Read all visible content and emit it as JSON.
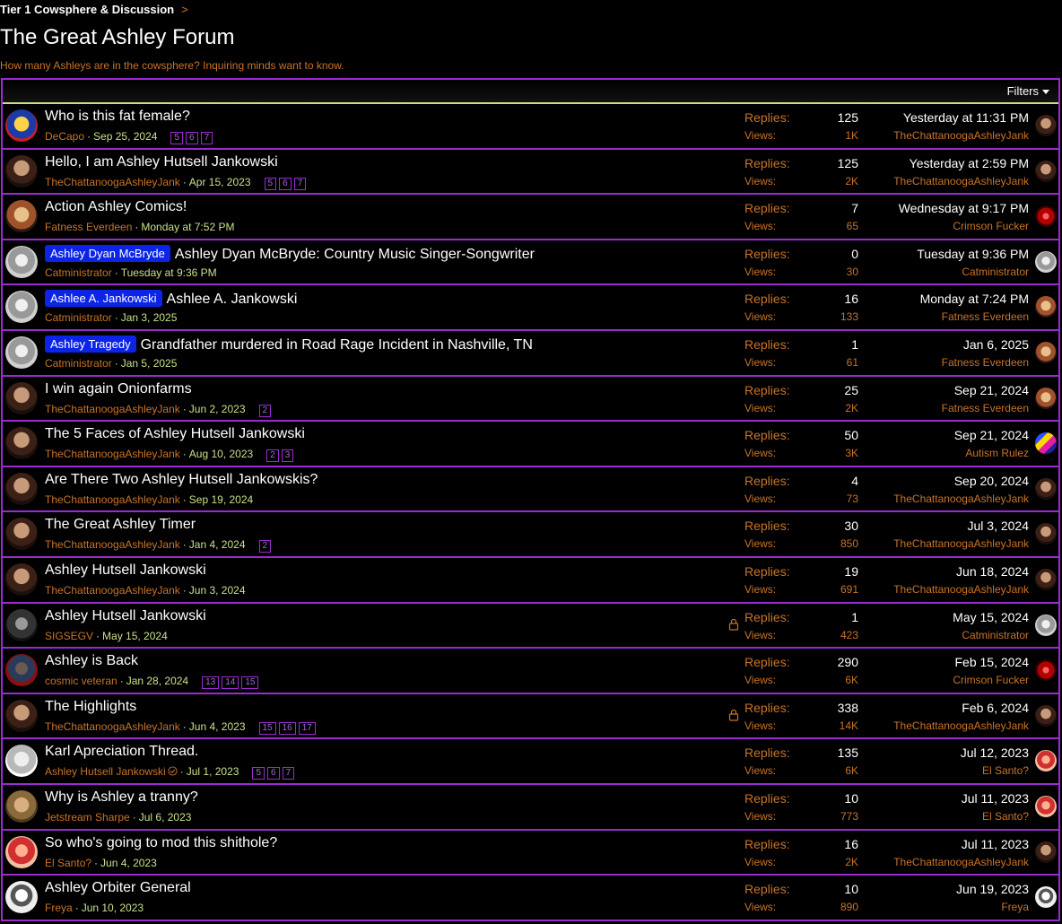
{
  "breadcrumb": {
    "label": "Tier 1 Cowsphere & Discussion",
    "sep": ">"
  },
  "forum": {
    "title": "The Great Ashley Forum",
    "description": "How many Ashleys are in the cowsphere? Inquiring minds want to know."
  },
  "filters_label": "Filters",
  "labels": {
    "replies": "Replies:",
    "views": "Views:"
  },
  "threads": [
    {
      "prefix": "",
      "title": "Who is this fat female?",
      "author": "DeCapo",
      "date": "Sep 25, 2024",
      "pages": [
        "5",
        "6",
        "7"
      ],
      "replies": "125",
      "views": "1K",
      "last_date": "Yesterday at 11:31 PM",
      "last_user": "TheChattanoogaAshleyJank",
      "locked": false,
      "avatar": "av-e",
      "last_avatar": "av-a"
    },
    {
      "prefix": "",
      "title": "Hello, I am Ashley Hutsell Jankowski",
      "author": "TheChattanoogaAshleyJank",
      "date": "Apr 15, 2023",
      "pages": [
        "5",
        "6",
        "7"
      ],
      "replies": "125",
      "views": "2K",
      "last_date": "Yesterday at 2:59 PM",
      "last_user": "TheChattanoogaAshleyJank",
      "locked": false,
      "avatar": "av-a",
      "last_avatar": "av-a"
    },
    {
      "prefix": "",
      "title": "Action Ashley Comics!",
      "author": "Fatness Everdeen",
      "date": "Monday at 7:52 PM",
      "pages": [],
      "replies": "7",
      "views": "65",
      "last_date": "Wednesday at 9:17 PM",
      "last_user": "Crimson Fucker",
      "locked": false,
      "avatar": "av-c",
      "last_avatar": "av-d"
    },
    {
      "prefix": "Ashley Dyan McBryde",
      "title": "Ashley Dyan McBryde: Country Music Singer-Songwriter",
      "author": "Catministrator",
      "date": "Tuesday at 9:36 PM",
      "pages": [],
      "replies": "0",
      "views": "30",
      "last_date": "Tuesday at 9:36 PM",
      "last_user": "Catministrator",
      "locked": false,
      "avatar": "av-b",
      "last_avatar": "av-b"
    },
    {
      "prefix": "Ashlee A. Jankowski",
      "title": "Ashlee A. Jankowski",
      "author": "Catministrator",
      "date": "Jan 3, 2025",
      "pages": [],
      "replies": "16",
      "views": "133",
      "last_date": "Monday at 7:24 PM",
      "last_user": "Fatness Everdeen",
      "locked": false,
      "avatar": "av-b",
      "last_avatar": "av-c"
    },
    {
      "prefix": "Ashley Tragedy",
      "title": "Grandfather murdered in Road Rage Incident in Nashville, TN",
      "author": "Catministrator",
      "date": "Jan 5, 2025",
      "pages": [],
      "replies": "1",
      "views": "61",
      "last_date": "Jan 6, 2025",
      "last_user": "Fatness Everdeen",
      "locked": false,
      "avatar": "av-b",
      "last_avatar": "av-c"
    },
    {
      "prefix": "",
      "title": "I win again Onionfarms",
      "author": "TheChattanoogaAshleyJank",
      "date": "Jun 2, 2023",
      "pages": [
        "2"
      ],
      "replies": "25",
      "views": "2K",
      "last_date": "Sep 21, 2024",
      "last_user": "Fatness Everdeen",
      "locked": false,
      "avatar": "av-a",
      "last_avatar": "av-c"
    },
    {
      "prefix": "",
      "title": "The 5 Faces of Ashley Hutsell Jankowski",
      "author": "TheChattanoogaAshleyJank",
      "date": "Aug 10, 2023",
      "pages": [
        "2",
        "3"
      ],
      "replies": "50",
      "views": "3K",
      "last_date": "Sep 21, 2024",
      "last_user": "Autism Rulez",
      "locked": false,
      "avatar": "av-a",
      "last_avatar": "av-l"
    },
    {
      "prefix": "",
      "title": "Are There Two Ashley Hutsell Jankowskis?",
      "author": "TheChattanoogaAshleyJank",
      "date": "Sep 19, 2024",
      "pages": [],
      "replies": "4",
      "views": "73",
      "last_date": "Sep 20, 2024",
      "last_user": "TheChattanoogaAshleyJank",
      "locked": false,
      "avatar": "av-a",
      "last_avatar": "av-a"
    },
    {
      "prefix": "",
      "title": "The Great Ashley Timer",
      "author": "TheChattanoogaAshleyJank",
      "date": "Jan 4, 2024",
      "pages": [
        "2"
      ],
      "replies": "30",
      "views": "850",
      "last_date": "Jul 3, 2024",
      "last_user": "TheChattanoogaAshleyJank",
      "locked": false,
      "avatar": "av-a",
      "last_avatar": "av-a"
    },
    {
      "prefix": "",
      "title": "Ashley Hutsell Jankowski",
      "author": "TheChattanoogaAshleyJank",
      "date": "Jun 3, 2024",
      "pages": [],
      "replies": "19",
      "views": "691",
      "last_date": "Jun 18, 2024",
      "last_user": "TheChattanoogaAshleyJank",
      "locked": false,
      "avatar": "av-a",
      "last_avatar": "av-a"
    },
    {
      "prefix": "",
      "title": "Ashley Hutsell Jankowski",
      "author": "SIGSEGV",
      "date": "May 15, 2024",
      "pages": [],
      "replies": "1",
      "views": "423",
      "last_date": "May 15, 2024",
      "last_user": "Catministrator",
      "locked": true,
      "avatar": "av-f",
      "last_avatar": "av-b"
    },
    {
      "prefix": "",
      "title": "Ashley is Back",
      "author": "cosmic veteran",
      "date": "Jan 28, 2024",
      "pages": [
        "13",
        "14",
        "15"
      ],
      "replies": "290",
      "views": "6K",
      "last_date": "Feb 15, 2024",
      "last_user": "Crimson Fucker",
      "locked": false,
      "avatar": "av-g",
      "last_avatar": "av-d"
    },
    {
      "prefix": "",
      "title": "The Highlights",
      "author": "TheChattanoogaAshleyJank",
      "date": "Jun 4, 2023",
      "pages": [
        "15",
        "16",
        "17"
      ],
      "replies": "338",
      "views": "14K",
      "last_date": "Feb 6, 2024",
      "last_user": "TheChattanoogaAshleyJank",
      "locked": true,
      "avatar": "av-a",
      "last_avatar": "av-a"
    },
    {
      "prefix": "",
      "title": "Karl Apreciation Thread.",
      "author": "Ashley Hutsell Jankowski",
      "date": "Jul 1, 2023",
      "pages": [
        "5",
        "6",
        "7"
      ],
      "replies": "135",
      "views": "6K",
      "last_date": "Jul 12, 2023",
      "last_user": "El Santo?",
      "locked": false,
      "avatar": "av-h",
      "last_avatar": "av-j",
      "verified": true
    },
    {
      "prefix": "",
      "title": "Why is Ashley a tranny?",
      "author": "Jetstream Sharpe",
      "date": "Jul 6, 2023",
      "pages": [],
      "replies": "10",
      "views": "773",
      "last_date": "Jul 11, 2023",
      "last_user": "El Santo?",
      "locked": false,
      "avatar": "av-i",
      "last_avatar": "av-j"
    },
    {
      "prefix": "",
      "title": "So who's going to mod this shithole?",
      "author": "El Santo?",
      "date": "Jun 4, 2023",
      "pages": [],
      "replies": "16",
      "views": "2K",
      "last_date": "Jul 11, 2023",
      "last_user": "TheChattanoogaAshleyJank",
      "locked": false,
      "avatar": "av-j",
      "last_avatar": "av-a"
    },
    {
      "prefix": "",
      "title": "Ashley Orbiter General",
      "author": "Freya",
      "date": "Jun 10, 2023",
      "pages": [],
      "replies": "10",
      "views": "890",
      "last_date": "Jun 19, 2023",
      "last_user": "Freya",
      "locked": false,
      "avatar": "av-k",
      "last_avatar": "av-k"
    }
  ]
}
